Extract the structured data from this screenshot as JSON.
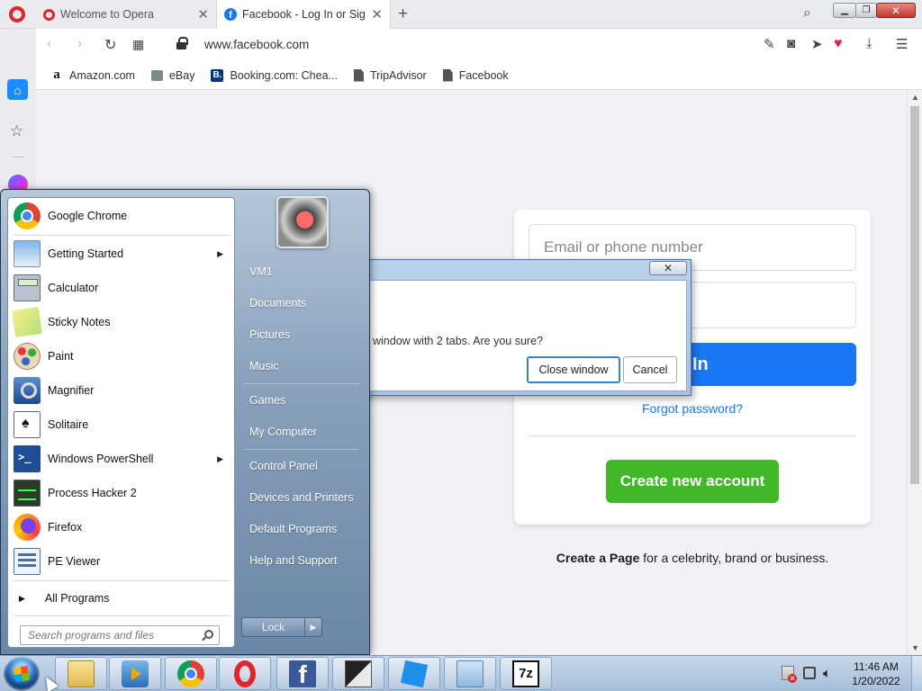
{
  "browser": {
    "tabs": [
      {
        "title": "Welcome to Opera",
        "favicon": "opera-icon"
      },
      {
        "title": "Facebook - Log In or Sign Up",
        "favicon": "facebook-icon",
        "active": true
      }
    ],
    "address": "www.facebook.com",
    "bookmarks": [
      {
        "label": "Amazon.com",
        "icon": "amazon-icon"
      },
      {
        "label": "eBay",
        "icon": "ebay-icon"
      },
      {
        "label": "Booking.com: Chea...",
        "icon": "booking-icon"
      },
      {
        "label": "TripAdvisor",
        "icon": "document-icon"
      },
      {
        "label": "Facebook",
        "icon": "document-icon"
      }
    ]
  },
  "facebook": {
    "email_placeholder": "Email or phone number",
    "login_label": "g In",
    "forgot": "Forgot password?",
    "create": "Create new account",
    "page_bold": "Create a Page",
    "page_rest": " for a celebrity, brand or business.",
    "colors": {
      "blue": "#1877f2",
      "green": "#42b72a"
    }
  },
  "dialog": {
    "message": "window with 2 tabs. Are you sure?",
    "confirm": "Close window",
    "cancel": "Cancel"
  },
  "start_menu": {
    "programs": [
      {
        "label": "Google Chrome",
        "icon": "chrome-icon",
        "submenu": false
      },
      {
        "label": "Getting Started",
        "icon": "getting-started-icon",
        "submenu": true
      },
      {
        "label": "Calculator",
        "icon": "calculator-icon",
        "submenu": false
      },
      {
        "label": "Sticky Notes",
        "icon": "sticky-notes-icon",
        "submenu": false
      },
      {
        "label": "Paint",
        "icon": "paint-icon",
        "submenu": false
      },
      {
        "label": "Magnifier",
        "icon": "magnifier-icon",
        "submenu": false
      },
      {
        "label": "Solitaire",
        "icon": "solitaire-icon",
        "submenu": false
      },
      {
        "label": "Windows PowerShell",
        "icon": "powershell-icon",
        "submenu": true
      },
      {
        "label": "Process Hacker 2",
        "icon": "process-hacker-icon",
        "submenu": false
      },
      {
        "label": "Firefox",
        "icon": "firefox-icon",
        "submenu": false
      },
      {
        "label": "PE Viewer",
        "icon": "pe-viewer-icon",
        "submenu": false
      }
    ],
    "all_programs": "All Programs",
    "search_placeholder": "Search programs and files",
    "right_items": [
      "VM1",
      "Documents",
      "Pictures",
      "Music",
      "Games",
      "My Computer",
      "Control Panel",
      "Devices and Printers",
      "Default Programs",
      "Help and Support"
    ],
    "lock_label": "Lock"
  },
  "taskbar": {
    "time": "11:46 AM",
    "date": "1/20/2022",
    "pinned": [
      "explorer-icon",
      "media-player-icon",
      "chrome-icon",
      "opera-icon",
      "facebook-icon",
      "setup-icon",
      "roblox-icon",
      "network-icon",
      "7zip-icon"
    ]
  }
}
